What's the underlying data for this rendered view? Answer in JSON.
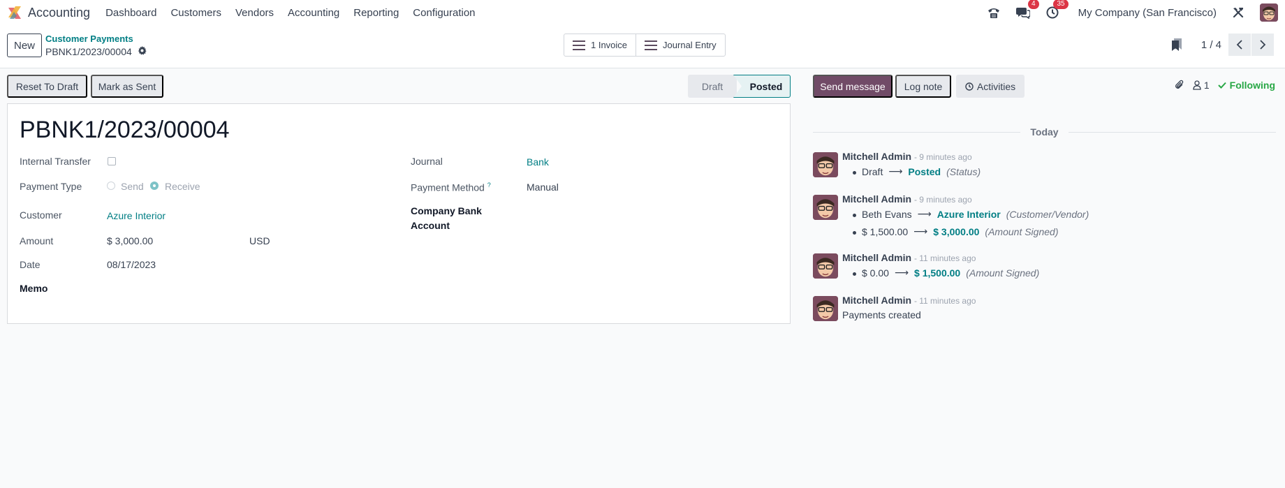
{
  "navbar": {
    "app_name": "Accounting",
    "menu": [
      "Dashboard",
      "Customers",
      "Vendors",
      "Accounting",
      "Reporting",
      "Configuration"
    ],
    "messages_count": "4",
    "activities_count": "35",
    "company": "My Company (San Francisco)"
  },
  "control_panel": {
    "new_label": "New",
    "breadcrumb_parent": "Customer Payments",
    "breadcrumb_current": "PBNK1/2023/00004",
    "smart_buttons": [
      "1 Invoice",
      "Journal Entry"
    ],
    "pager_value": "1 / 4"
  },
  "statusbar": {
    "reset_label": "Reset To Draft",
    "mark_sent_label": "Mark as Sent",
    "stages": [
      "Draft",
      "Posted"
    ],
    "current_stage": "Posted"
  },
  "form": {
    "title": "PBNK1/2023/00004",
    "internal_transfer_label": "Internal Transfer",
    "payment_type_label": "Payment Type",
    "payment_type_options": [
      "Send",
      "Receive"
    ],
    "payment_type_selected": "Receive",
    "customer_label": "Customer",
    "customer_value": "Azure Interior",
    "amount_label": "Amount",
    "amount_value": "$ 3,000.00",
    "currency_value": "USD",
    "date_label": "Date",
    "date_value": "08/17/2023",
    "memo_label": "Memo",
    "journal_label": "Journal",
    "journal_value": "Bank",
    "payment_method_label": "Payment Method",
    "payment_method_help": "?",
    "payment_method_value": "Manual",
    "company_bank_label_1": "Company Bank",
    "company_bank_label_2": "Account"
  },
  "chatter": {
    "send_message_label": "Send message",
    "log_note_label": "Log note",
    "activities_label": "Activities",
    "followers_count": "1",
    "following_label": "Following",
    "date_separator": "Today",
    "messages": [
      {
        "author": "Mitchell Admin",
        "time": "- 9 minutes ago",
        "tracking": [
          {
            "old": "Draft",
            "new": "Posted",
            "field": "(Status)"
          }
        ]
      },
      {
        "author": "Mitchell Admin",
        "time": "- 9 minutes ago",
        "tracking": [
          {
            "old": "Beth Evans",
            "new": "Azure Interior",
            "field": "(Customer/Vendor)"
          },
          {
            "old": "$ 1,500.00",
            "new": "$ 3,000.00",
            "field": "(Amount Signed)"
          }
        ]
      },
      {
        "author": "Mitchell Admin",
        "time": "- 11 minutes ago",
        "tracking": [
          {
            "old": "$ 0.00",
            "new": "$ 1,500.00",
            "field": "(Amount Signed)"
          }
        ]
      },
      {
        "author": "Mitchell Admin",
        "time": "- 11 minutes ago",
        "body": "Payments created"
      }
    ]
  },
  "colors": {
    "brand": "#714b67",
    "link": "#017e84",
    "badge": "#dc3545",
    "following": "#28a745"
  }
}
